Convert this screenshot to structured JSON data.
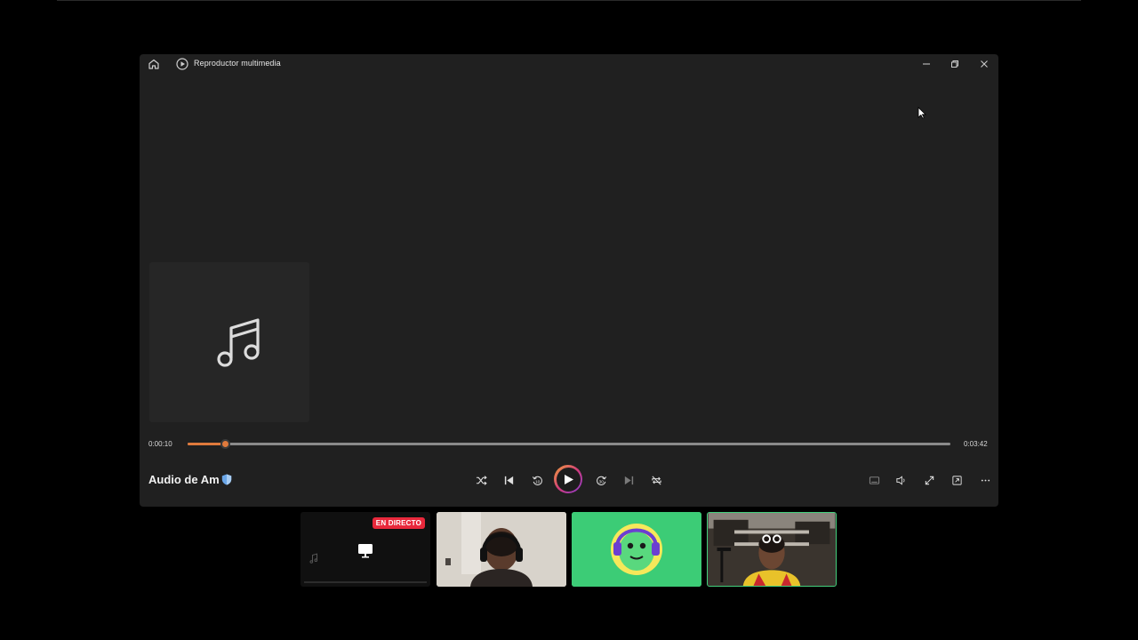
{
  "window": {
    "title": "Reproductor multimedia",
    "icons": {
      "home": "home-icon",
      "app": "play-circle-icon",
      "minimize": "minimize-icon",
      "restore": "restore-icon",
      "close": "close-icon"
    }
  },
  "player": {
    "current_time": "0:00:10",
    "duration": "0:03:42",
    "progress_fraction": 0.049,
    "track_title": "Audio de Am",
    "title_badge_icon": "shield-icon",
    "album_art_icon": "music-note-icon",
    "accent_color": "#e07a3c",
    "controls": {
      "shuffle": "shuffle-icon",
      "previous": "previous-track-icon",
      "rewind": "rewind-10-icon",
      "play": "play-icon",
      "forward": "forward-30-icon",
      "next": "next-track-icon",
      "repeat": "repeat-off-icon"
    },
    "right_controls": {
      "captions": "captions-icon",
      "volume": "volume-icon",
      "fullscreen": "fullscreen-icon",
      "miniplayer": "miniplayer-icon",
      "more": "more-options-icon"
    }
  },
  "participants": {
    "live_badge": "EN DIRECTO",
    "screen_share_icon": "monitor-icon"
  }
}
